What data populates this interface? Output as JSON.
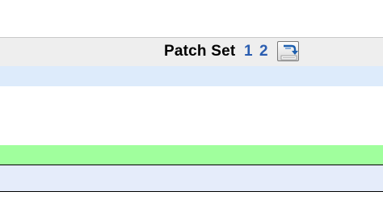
{
  "patchset_header": {
    "label": "Patch Set",
    "links": [
      "1",
      "2"
    ],
    "download_icon": "download-archive-icon"
  },
  "colors": {
    "header_bg": "#eeeeee",
    "link": "#2a5db0",
    "row_blue": "#ddebfb",
    "row_green": "#a0ff9d",
    "row_lavender": "#e5ecfa"
  }
}
